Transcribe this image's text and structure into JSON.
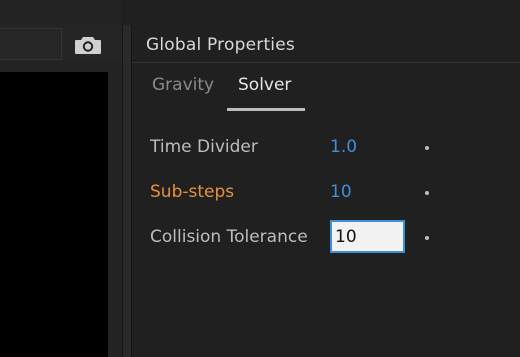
{
  "panel": {
    "title": "Global Properties",
    "tabs": [
      {
        "label": "Gravity",
        "selected": false
      },
      {
        "label": "Solver",
        "selected": true
      }
    ]
  },
  "properties": [
    {
      "label": "Time Divider",
      "value": "1.0",
      "state": "normal"
    },
    {
      "label": "Sub-steps",
      "value": "10",
      "state": "modified"
    },
    {
      "label": "Collision Tolerance",
      "value": "10",
      "state": "editing"
    }
  ],
  "viewer": {
    "camera_icon": "camera-icon"
  },
  "colors": {
    "accent_blue": "#3d8fd9",
    "modified_orange": "#e8913c",
    "panel_bg": "#202020"
  }
}
